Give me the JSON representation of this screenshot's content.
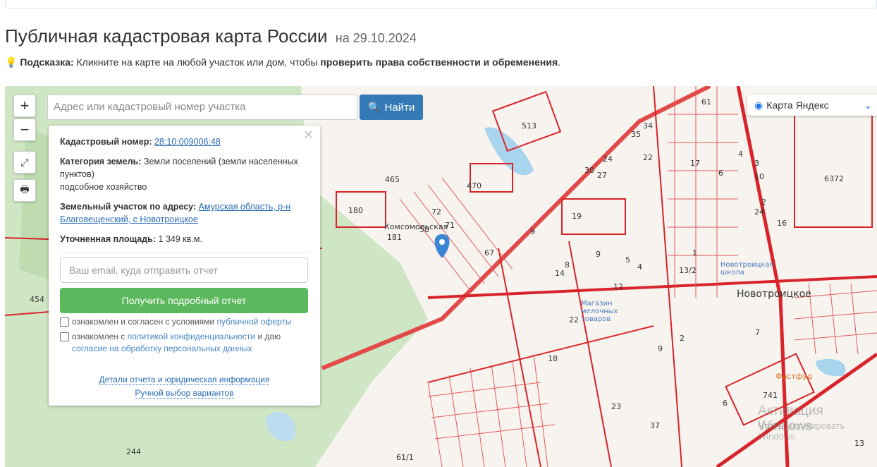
{
  "header": {
    "title": "Публичная кадастровая карта России",
    "date": "на 29.10.2024"
  },
  "hint": {
    "label": "Подсказка:",
    "text": " Кликните на карте на любой участок или дом, чтобы ",
    "bold": "проверить права собственности и обременения",
    "end": "."
  },
  "map": {
    "search_placeholder": "Адрес или кадастровый номер участка",
    "find_label": "Найти",
    "layer_label": "Карта Яндекс",
    "zoom_in": "+",
    "zoom_out": "−",
    "labels": [
      "513",
      "465",
      "470",
      "180",
      "72",
      "58",
      "71",
      "181",
      "67",
      "9",
      "19",
      "24",
      "30",
      "27",
      "35",
      "34",
      "22",
      "61",
      "17",
      "3",
      "10",
      "4",
      "6",
      "2",
      "24",
      "16",
      "6372",
      "14",
      "8",
      "9",
      "5",
      "4",
      "12",
      "13/2",
      "1",
      "22",
      "18",
      "9",
      "2",
      "6",
      "7",
      "741",
      "454",
      "244",
      "61/1",
      "37",
      "23",
      "13",
      "Новотроицкое",
      "Фастфуд",
      "Магазин мелочных товаров",
      "Новотроицкая школа",
      "Комсомольская"
    ],
    "watermark": "Активация Windows",
    "watermark_sub": "Чтобы активировать Windows"
  },
  "popup": {
    "cadastral_label": "Кадастровый номер:",
    "cadastral_value": "28:10:009006:48",
    "category_label": "Категория земель:",
    "category_value": "Земли поселений (земли населенных пунктов)",
    "category_use": "подсобное хозяйство",
    "address_label": "Земельный участок по адресу:",
    "address_value": "Амурская область, р-н Благовещенский, с Новотроицкое",
    "area_label": "Уточненная площадь:",
    "area_value": "1 349 кв.м.",
    "email_placeholder": "Ваш email, куда отправить отчет",
    "get_report": "Получить подробный отчет",
    "check1_text": "ознакомлен и согласен с условиями ",
    "check1_link": "публичной оферты",
    "check2_text": "ознакомлен с ",
    "check2_link": "политикой конфиденциальности",
    "check2_mid": " и даю ",
    "check2_link2": "согласие на обработку персональных данных",
    "details_link": "Детали отчета и юридическая информация",
    "manual_link": "Ручной выбор вариантов"
  }
}
